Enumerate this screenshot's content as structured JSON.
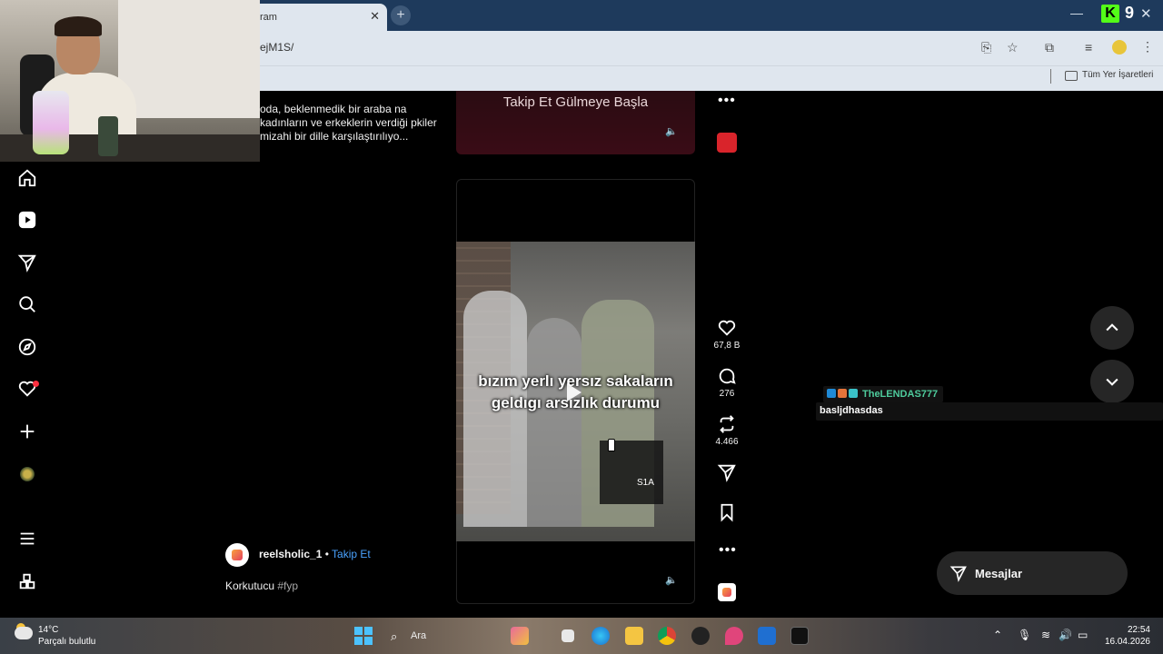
{
  "browser": {
    "tab_title": "ram",
    "tab_close": "✕",
    "new_tab": "+",
    "url": "ejM1S/",
    "bookmarks_label": "Tüm Yer İşaretleri",
    "overlay_brand": "K",
    "overlay_count": "9",
    "min": "—",
    "close": "✕"
  },
  "previous_post": {
    "caption": "oda, beklenmedik bir araba na kadınların ve erkeklerin verdiği pkiler mizahi bir dille karşılaştırılıyo...",
    "banner_text": "Takip Et Gülmeye Başla",
    "more": "•••"
  },
  "reel": {
    "video_caption_line1": "bızım yerlı yersız sakaların",
    "video_caption_line2": "geldıgı arsızlık durumu",
    "watermark": "S1A",
    "likes": "67,8 B",
    "comments": "276",
    "reposts": "4.466",
    "more": "•••",
    "author": "reelsholic_1",
    "separator": " • ",
    "follow": "Takip Et",
    "caption_text": "Korkutucu ",
    "caption_tag": "#fyp"
  },
  "chat": {
    "user": "TheLENDAS777",
    "message": "basljdhasdas"
  },
  "messages": {
    "label": "Mesajlar"
  },
  "taskbar": {
    "temp": "14°C",
    "condition": "Parçalı bulutlu",
    "search": "Ara",
    "time": "22:54",
    "date": "16.04.2026"
  },
  "colors": {
    "follow": "#4aa3ff",
    "notification": "#ff3040",
    "chat_user": "#4ecb9c"
  },
  "icons": [
    "home-icon",
    "reels-icon",
    "direct-icon",
    "search-icon",
    "explore-icon",
    "heart-icon",
    "create-icon",
    "menu-icon",
    "more-apps-icon"
  ]
}
